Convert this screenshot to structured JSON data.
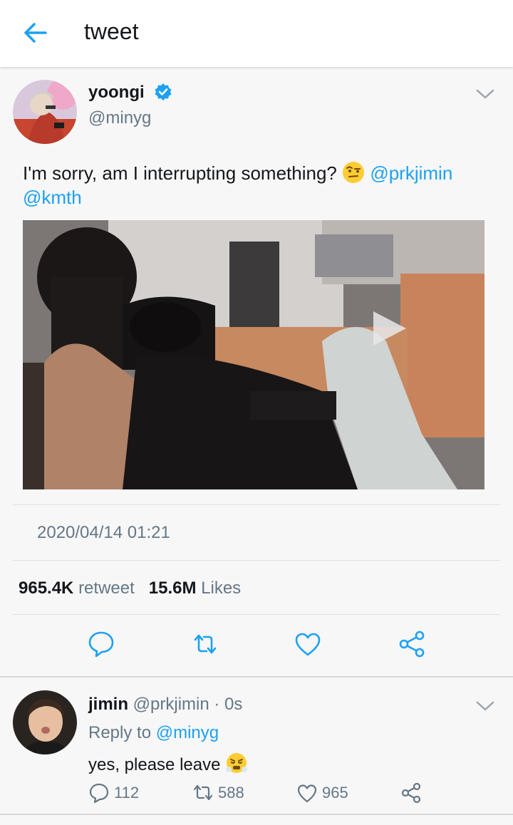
{
  "header": {
    "title": "tweet"
  },
  "tweet": {
    "name": "yoongi",
    "handle": "@minyg",
    "text_before": "I'm sorry, am I interrupting something? ",
    "mention1": "@prkjimin",
    "mention2": "@kmth",
    "timestamp": "2020/04/14 01:21",
    "retweets": "965.4K",
    "retweets_label": "retweet",
    "likes": "15.6M",
    "likes_label": "Likes"
  },
  "reply": {
    "name": "jimin",
    "meta": " @prkjimin · 0s",
    "reply_prefix": "Reply to ",
    "reply_mention": "@minyg",
    "text": "yes, please leave",
    "replies": "112",
    "retweets": "588",
    "likes": "965"
  },
  "colors": {
    "accent": "#1da1f2",
    "muted": "#657786",
    "background": "#f7f7f8"
  },
  "icons": [
    "back-arrow-icon",
    "verified-icon",
    "chevron-down-icon",
    "reply-icon",
    "retweet-icon",
    "like-icon",
    "share-icon",
    "play-icon"
  ]
}
